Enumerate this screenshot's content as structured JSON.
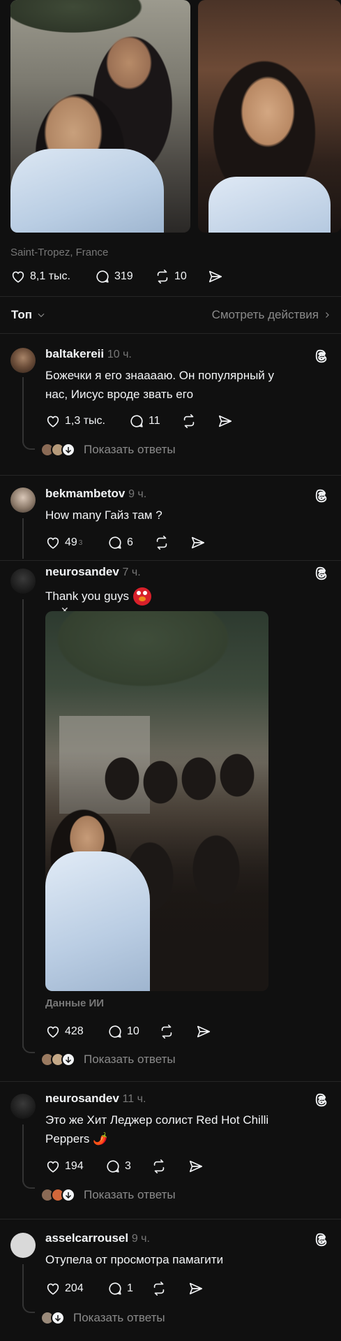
{
  "post": {
    "location": "Saint-Tropez, France",
    "likes": "8,1 тыс.",
    "comments": "319",
    "reposts": "10"
  },
  "toolbar": {
    "sort_label": "Топ",
    "activity_label": "Смотреть действия"
  },
  "comments": [
    {
      "username": "baltakereii",
      "time": "10 ч.",
      "text_line1": "Божечки я его знааааю. Он популярный у",
      "text_line2": "нас, Иисус вроде звать его",
      "likes": "1,3 тыс.",
      "replies_count": "11",
      "show_replies": "Показать ответы"
    },
    {
      "username": "bekmambetov",
      "time": "9 ч.",
      "text": "How many Гайз там ?",
      "likes": "49",
      "likes_sup": "3",
      "replies_count": "6"
    },
    {
      "username": "neurosandev",
      "time": "7 ч.",
      "text": "Thank you guys",
      "image_caption": "Данные ИИ",
      "likes": "428",
      "replies_count": "10",
      "show_replies": "Показать ответы"
    },
    {
      "username": "neurosandev",
      "time": "11 ч.",
      "text_line1": "Это же Хит Леджер солист Red Hot Chilli",
      "text_line2": "Peppers 🌶️",
      "likes": "194",
      "replies_count": "3",
      "show_replies": "Показать ответы"
    },
    {
      "username": "asselcarrousel",
      "time": "9 ч.",
      "text": "Отупела от просмотра памагити",
      "likes": "204",
      "replies_count": "1",
      "show_replies": "Показать ответы"
    }
  ],
  "colors": {
    "background": "#101010",
    "text": "#f3f5f7",
    "muted": "#777777",
    "divider": "#262626"
  }
}
